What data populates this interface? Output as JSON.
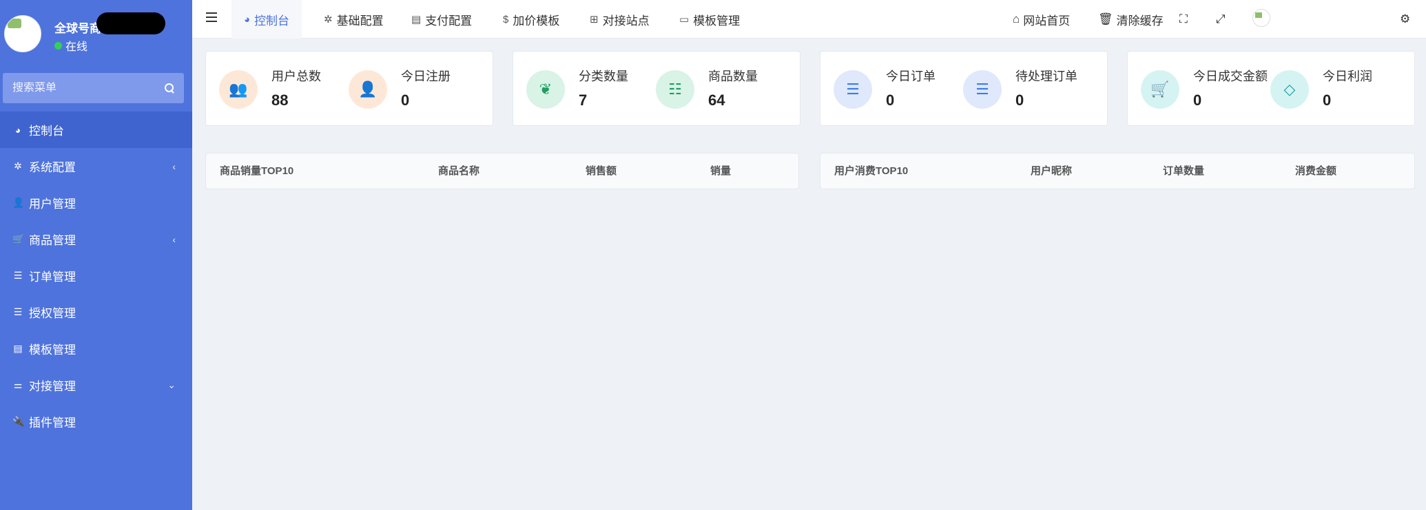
{
  "sidebar": {
    "user_name": "全球号商",
    "status": "在线",
    "search_placeholder": "搜索菜单",
    "items": [
      {
        "label": "控制台",
        "icon": "dashboard-icon",
        "glyph": "◕",
        "active": true,
        "arrow": ""
      },
      {
        "label": "系统配置",
        "icon": "gear-icon",
        "glyph": "✲",
        "active": false,
        "arrow": "‹"
      },
      {
        "label": "用户管理",
        "icon": "user-icon",
        "glyph": "👤",
        "active": false,
        "arrow": ""
      },
      {
        "label": "商品管理",
        "icon": "cart-icon",
        "glyph": "🛒",
        "active": false,
        "arrow": "‹"
      },
      {
        "label": "订单管理",
        "icon": "list-icon",
        "glyph": "☰",
        "active": false,
        "arrow": ""
      },
      {
        "label": "授权管理",
        "icon": "list-icon",
        "glyph": "☰",
        "active": false,
        "arrow": ""
      },
      {
        "label": "模板管理",
        "icon": "template-icon",
        "glyph": "▤",
        "active": false,
        "arrow": ""
      },
      {
        "label": "对接管理",
        "icon": "sliders-icon",
        "glyph": "⚌",
        "active": false,
        "arrow": "⌄"
      },
      {
        "label": "插件管理",
        "icon": "plug-icon",
        "glyph": "🔌",
        "active": false,
        "arrow": ""
      }
    ]
  },
  "topbar": {
    "tabs": [
      {
        "label": "控制台",
        "icon": "dashboard-icon",
        "glyph": "◕"
      },
      {
        "label": "基础配置",
        "icon": "gear-icon",
        "glyph": "✲"
      },
      {
        "label": "支付配置",
        "icon": "server-icon",
        "glyph": "▤"
      },
      {
        "label": "加价模板",
        "icon": "dollar-icon",
        "glyph": "$"
      },
      {
        "label": "对接站点",
        "icon": "sitemap-icon",
        "glyph": "⊞"
      },
      {
        "label": "模板管理",
        "icon": "window-icon",
        "glyph": "▭"
      }
    ],
    "site_home": "网站首页",
    "clear_cache": "清除缓存"
  },
  "stats": [
    {
      "label": "用户总数",
      "value": "88",
      "icon": "users-icon",
      "glyph": "👥",
      "color": "orange"
    },
    {
      "label": "今日注册",
      "value": "0",
      "icon": "user-icon",
      "glyph": "👤",
      "color": "orange"
    },
    {
      "label": "分类数量",
      "value": "7",
      "icon": "leaf-icon",
      "glyph": "❦",
      "color": "green"
    },
    {
      "label": "商品数量",
      "value": "64",
      "icon": "list-icon",
      "glyph": "☷",
      "color": "green"
    },
    {
      "label": "今日订单",
      "value": "0",
      "icon": "bars-icon",
      "glyph": "☰",
      "color": "blue"
    },
    {
      "label": "待处理订单",
      "value": "0",
      "icon": "bars-icon",
      "glyph": "☰",
      "color": "blue"
    },
    {
      "label": "今日成交金额",
      "value": "0",
      "icon": "cart-icon",
      "glyph": "🛒",
      "color": "teal"
    },
    {
      "label": "今日利润",
      "value": "0",
      "icon": "diamond-icon",
      "glyph": "◇",
      "color": "teal"
    }
  ],
  "product_table": {
    "headers": [
      "商品销量TOP10",
      "商品名称",
      "销售额",
      "销量"
    ]
  },
  "user_table": {
    "headers": [
      "用户消费TOP10",
      "用户昵称",
      "订单数量",
      "消费金额"
    ]
  },
  "colors": {
    "sidebar": "#4f73dc",
    "sidebar_active": "#3f63cf",
    "accent": "#4f73dc",
    "background": "#eef2f6"
  }
}
